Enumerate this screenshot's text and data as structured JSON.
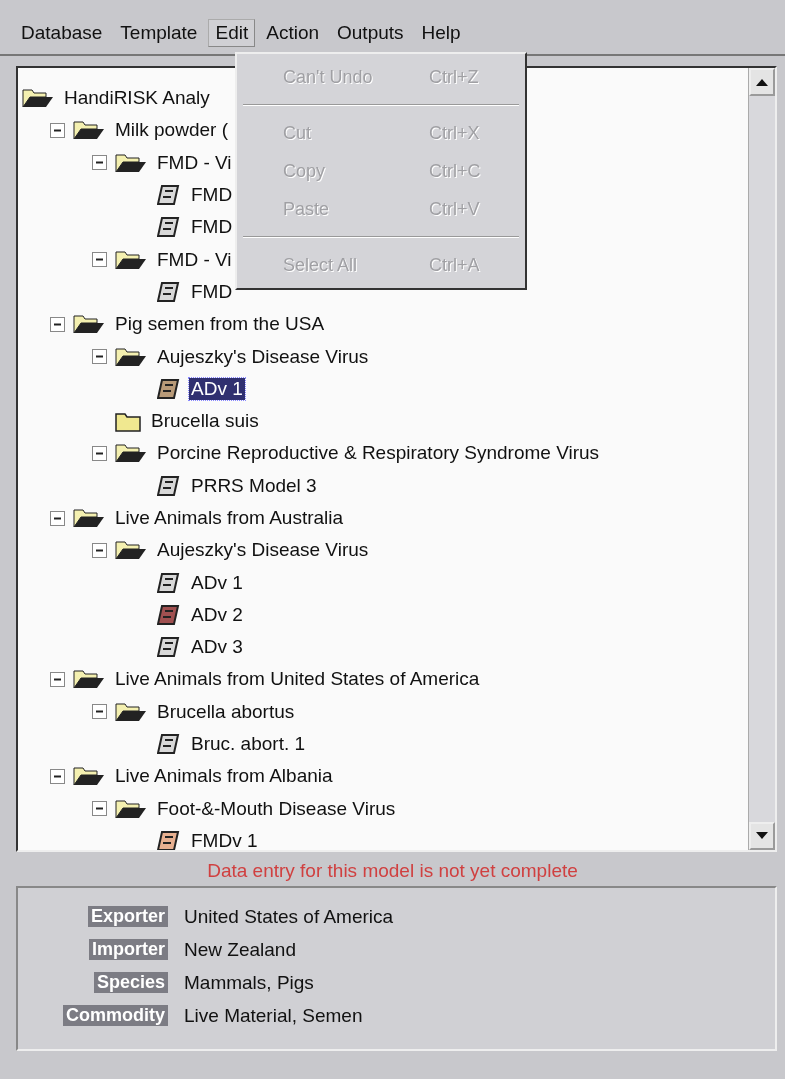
{
  "menubar": [
    {
      "label": "Database",
      "selected": false
    },
    {
      "label": "Template",
      "selected": false
    },
    {
      "label": "Edit",
      "selected": true
    },
    {
      "label": "Action",
      "selected": false
    },
    {
      "label": "Outputs",
      "selected": false
    },
    {
      "label": "Help",
      "selected": false
    }
  ],
  "edit_menu": [
    {
      "kind": "item",
      "label": "Can't Undo",
      "shortcut": "Ctrl+Z",
      "disabled": true
    },
    {
      "kind": "separator"
    },
    {
      "kind": "item",
      "label": "Cut",
      "shortcut": "Ctrl+X",
      "disabled": true
    },
    {
      "kind": "item",
      "label": "Copy",
      "shortcut": "Ctrl+C",
      "disabled": true
    },
    {
      "kind": "item",
      "label": "Paste",
      "shortcut": "Ctrl+V",
      "disabled": true
    },
    {
      "kind": "separator"
    },
    {
      "kind": "item",
      "label": "Select All",
      "shortcut": "Ctrl+A",
      "disabled": true
    }
  ],
  "tree": {
    "label": "HandiRISK Analy",
    "kind": "folder",
    "expanded": true,
    "selected": false,
    "children": [
      {
        "label": "Milk powder (",
        "kind": "folder",
        "expanded": true,
        "selected": false,
        "children": [
          {
            "label": "FMD - Vi",
            "kind": "folder",
            "expanded": true,
            "selected": false,
            "children": [
              {
                "label": "FMD",
                "kind": "model",
                "selected": false,
                "color": "#d8d8d8"
              },
              {
                "label": "FMD",
                "kind": "model",
                "selected": false,
                "color": "#d8d8d8"
              }
            ]
          },
          {
            "label": "FMD - Vi",
            "kind": "folder",
            "expanded": true,
            "selected": false,
            "children": [
              {
                "label": "FMD",
                "kind": "model",
                "selected": false,
                "color": "#d8d8d8"
              }
            ]
          }
        ]
      },
      {
        "label": "Pig semen from the USA",
        "kind": "folder",
        "expanded": true,
        "selected": false,
        "children": [
          {
            "label": "Aujeszky's Disease Virus",
            "kind": "folder",
            "expanded": true,
            "selected": false,
            "children": [
              {
                "label": "ADv 1",
                "kind": "model",
                "selected": true,
                "color": "#b89a78"
              }
            ]
          },
          {
            "label": "Brucella suis",
            "kind": "folder",
            "expanded": false,
            "selected": false
          },
          {
            "label": "Porcine Reproductive & Respiratory Syndrome Virus",
            "kind": "folder",
            "expanded": true,
            "selected": false,
            "children": [
              {
                "label": "PRRS Model 3",
                "kind": "model",
                "selected": false,
                "color": "#d8d8d8"
              }
            ]
          }
        ]
      },
      {
        "label": "Live Animals from Australia",
        "kind": "folder",
        "expanded": true,
        "selected": false,
        "children": [
          {
            "label": "Aujeszky's Disease Virus",
            "kind": "folder",
            "expanded": true,
            "selected": false,
            "children": [
              {
                "label": "ADv 1",
                "kind": "model",
                "selected": false,
                "color": "#d8d8d8"
              },
              {
                "label": "ADv 2",
                "kind": "model",
                "selected": false,
                "color": "#a05050"
              },
              {
                "label": "ADv 3",
                "kind": "model",
                "selected": false,
                "color": "#d8d8d8"
              }
            ]
          }
        ]
      },
      {
        "label": "Live Animals from United States of America",
        "kind": "folder",
        "expanded": true,
        "selected": false,
        "children": [
          {
            "label": "Brucella abortus",
            "kind": "folder",
            "expanded": true,
            "selected": false,
            "children": [
              {
                "label": "Bruc. abort. 1",
                "kind": "model",
                "selected": false,
                "color": "#d8d8d8"
              }
            ]
          }
        ]
      },
      {
        "label": "Live Animals from Albania",
        "kind": "folder",
        "expanded": true,
        "selected": false,
        "children": [
          {
            "label": "Foot-&-Mouth Disease Virus",
            "kind": "folder",
            "expanded": true,
            "selected": false,
            "children": [
              {
                "label": "FMDv 1",
                "kind": "model",
                "selected": false,
                "color": "#e8b090"
              }
            ]
          }
        ]
      }
    ]
  },
  "status_message": "Data entry for this model is not yet complete",
  "details": [
    {
      "label": "Exporter",
      "value": "United States of America"
    },
    {
      "label": "Importer",
      "value": "New Zealand"
    },
    {
      "label": "Species",
      "value": "Mammals, Pigs"
    },
    {
      "label": "Commodity",
      "value": "Live Material, Semen"
    }
  ]
}
